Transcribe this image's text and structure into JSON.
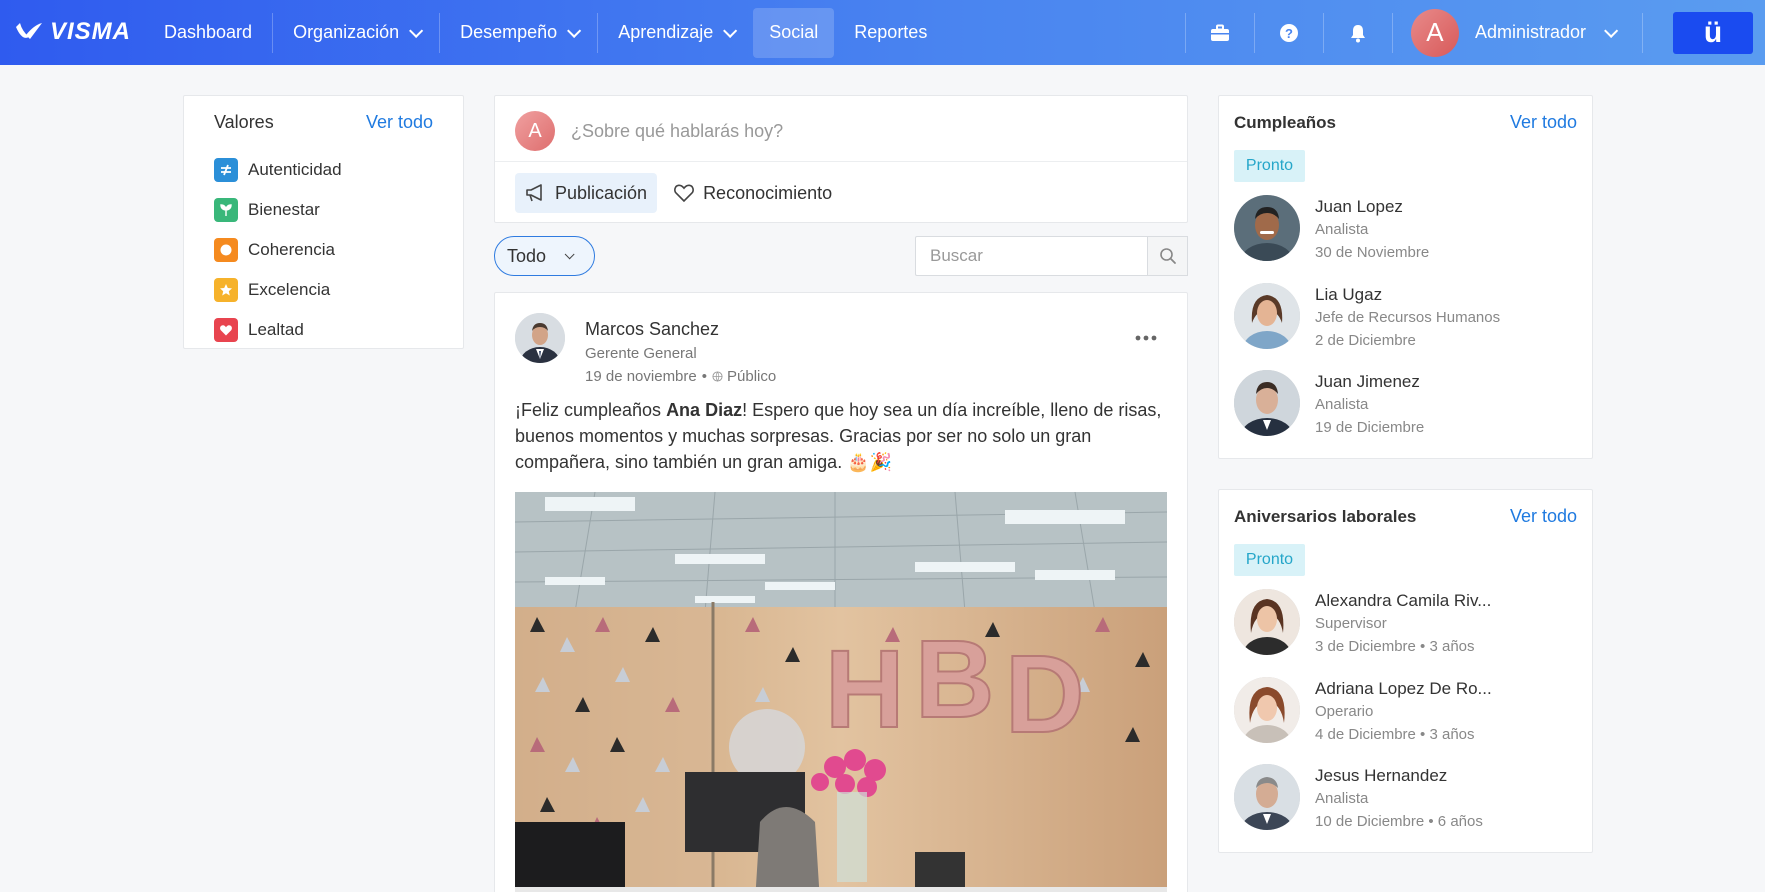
{
  "nav": {
    "brand": "VISMA",
    "items": [
      {
        "label": "Dashboard",
        "dropdown": false
      },
      {
        "label": "Organización",
        "dropdown": true
      },
      {
        "label": "Desempeño",
        "dropdown": true
      },
      {
        "label": "Aprendizaje",
        "dropdown": true
      },
      {
        "label": "Social",
        "dropdown": false,
        "active": true
      },
      {
        "label": "Reportes",
        "dropdown": false
      }
    ],
    "user": {
      "initial": "A",
      "name": "Administrador"
    },
    "app_button": "ü",
    "accent": "#2f5bef"
  },
  "valores": {
    "title": "Valores",
    "see_all": "Ver todo",
    "items": [
      {
        "label": "Autenticidad",
        "color": "#2b8fd8",
        "icon": "not-equal-icon"
      },
      {
        "label": "Bienestar",
        "color": "#39b77a",
        "icon": "sprout-icon"
      },
      {
        "label": "Coherencia",
        "color": "#f58a1f",
        "icon": "circle-icon"
      },
      {
        "label": "Excelencia",
        "color": "#f6b22b",
        "icon": "star-icon"
      },
      {
        "label": "Lealtad",
        "color": "#e8444f",
        "icon": "heart-icon"
      }
    ]
  },
  "composer": {
    "initial": "A",
    "placeholder": "¿Sobre qué hablarás hoy?",
    "tab_post": "Publicación",
    "tab_recognition": "Reconocimiento"
  },
  "filter": {
    "selected": "Todo"
  },
  "search": {
    "placeholder": "Buscar"
  },
  "post": {
    "author": "Marcos Sanchez",
    "role": "Gerente General",
    "date": "19 de noviembre",
    "visibility": "Público",
    "text_before": "¡Feliz cumpleaños ",
    "mention": "Ana Diaz",
    "text_after": "! Espero que hoy sea un día increíble, lleno de risas, buenos momentos y muchas sorpresas. Gracias por ser no solo un gran compañera, sino también un gran amiga. 🎂🎉",
    "balloons": [
      "H",
      "B",
      "D"
    ]
  },
  "cumpleanos": {
    "title": "Cumpleaños",
    "see_all": "Ver todo",
    "badge": "Pronto",
    "people": [
      {
        "name": "Juan Lopez",
        "role": "Analista",
        "date": "30 de Noviembre"
      },
      {
        "name": "Lia Ugaz",
        "role": "Jefe de Recursos Humanos",
        "date": "2 de Diciembre"
      },
      {
        "name": "Juan Jimenez",
        "role": "Analista",
        "date": "19 de Diciembre"
      }
    ]
  },
  "aniversarios": {
    "title": "Aniversarios laborales",
    "see_all": "Ver todo",
    "badge": "Pronto",
    "people": [
      {
        "name": "Alexandra Camila Riv...",
        "role": "Supervisor",
        "date": "3 de Diciembre • 3 años"
      },
      {
        "name": "Adriana Lopez De Ro...",
        "role": "Operario",
        "date": "4 de Diciembre • 3 años"
      },
      {
        "name": "Jesus Hernandez",
        "role": "Analista",
        "date": "10 de Diciembre • 6 años"
      }
    ]
  }
}
